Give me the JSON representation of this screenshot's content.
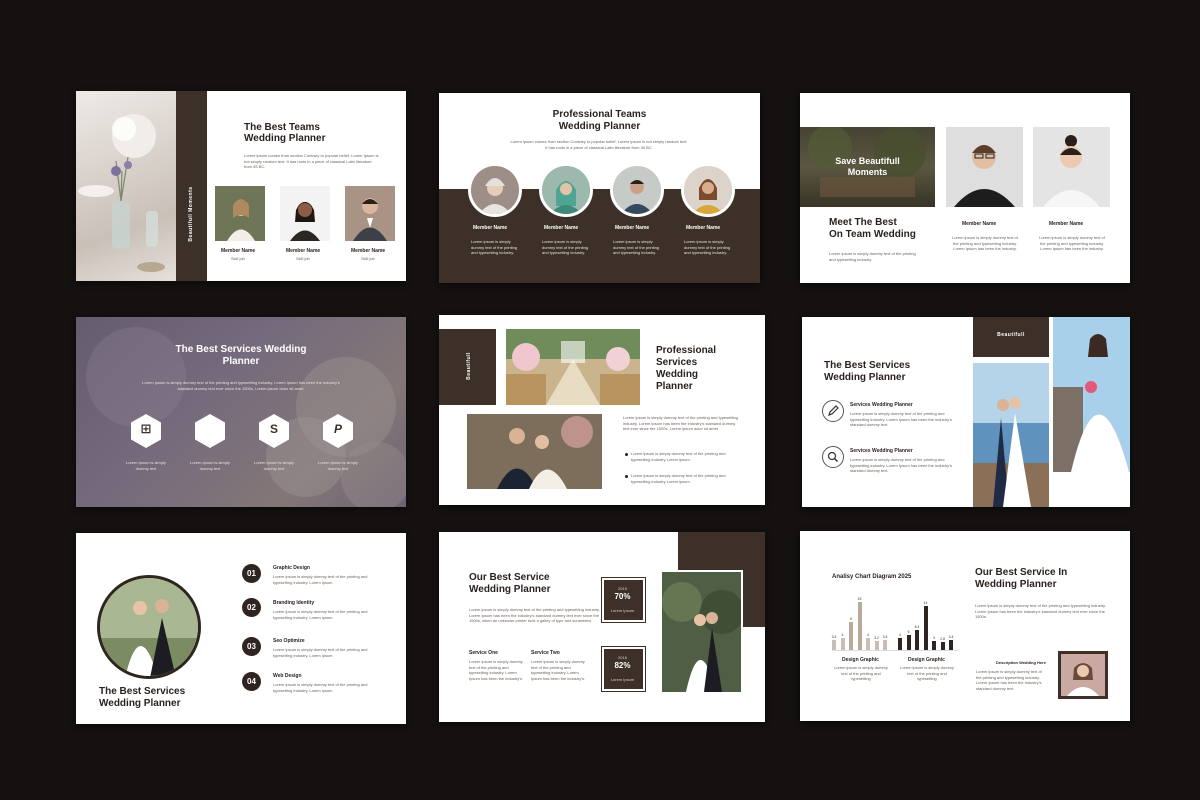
{
  "slides": {
    "s1": {
      "title1": "The Best Teams",
      "title2": "Wedding Planner",
      "body": "Lorem ipsum comes from section Contrary to popular belief, Lorem Ipsum is not simply random text. It has roots in a piece of classical Latin literature from 45 BC.",
      "side_label": "Beautifull Moments",
      "members": [
        {
          "name": "Member Name",
          "role": "Skill job"
        },
        {
          "name": "Member Name",
          "role": "Skill job"
        },
        {
          "name": "Member Name",
          "role": "Skill job"
        }
      ]
    },
    "s2": {
      "title1": "Professional Teams",
      "title2": "Wedding Planner",
      "body": "Lorem ipsum comes from section Contrary to popular belief, Lorem Ipsum is not simply random text. It has roots in a piece of classical Latin literature from 45 BC.",
      "members": [
        {
          "name": "Member Name",
          "desc": "Lorem ipsum is simply dummy text of the printing and typesetting industry."
        },
        {
          "name": "Member Name",
          "desc": "Lorem ipsum is simply dummy text of the printing and typesetting industry."
        },
        {
          "name": "Member Name",
          "desc": "Lorem ipsum is simply dummy text of the printing and typesetting industry."
        },
        {
          "name": "Member Name",
          "desc": "Lorem ipsum is simply dummy text of the printing and typesetting industry."
        }
      ]
    },
    "s3": {
      "overlay1": "Save Beautifull",
      "overlay2": "Moments",
      "title1": "Meet The Best",
      "title2": "On Team Wedding",
      "body": "Lorem ipsum is simply dummy text of the printing and typesetting industry.",
      "members": [
        {
          "name": "Member Name",
          "desc": "Lorem ipsum is simply dummy text of the printing and typesetting industry. Lorem Ipsum has been the industry."
        },
        {
          "name": "Member Name",
          "desc": "Lorem ipsum is simply dummy text of the printing and typesetting industry. Lorem Ipsum has been the industry."
        }
      ]
    },
    "s4": {
      "title1": "The Best Services Wedding",
      "title2": "Planner",
      "body": "Lorem ipsum is simply dummy text of the printing and typesetting industry. Lorem Ipsum has been the industry's standard dummy text ever since the 1500s, Lorem ipsum dolor sit amet.",
      "icons": [
        {
          "name": "windows-icon",
          "glyph": "⊞",
          "desc": "Lorem Ipsum is simply dummy text"
        },
        {
          "name": "apple-icon",
          "glyph": "",
          "desc": "Lorem Ipsum is simply dummy text"
        },
        {
          "name": "skype-icon",
          "glyph": "S",
          "desc": "Lorem Ipsum is simply dummy text"
        },
        {
          "name": "paypal-icon",
          "glyph": "P",
          "desc": "Lorem Ipsum is simply dummy text"
        }
      ]
    },
    "s5": {
      "side_label": "Beautifull",
      "title1": "Professional",
      "title2": "Services",
      "title3": "Wedding",
      "title4": "Planner",
      "body": "Lorem ipsum is simply dummy text of the printing and typesetting industry. Lorem Ipsum has been the industry's standard dummy text ever since the 1500s, Lorem ipsum dolor sit amet.",
      "bullets": [
        "Lorem ipsum is simply dummy text of the printing and typesetting industry Lorem ipsum",
        "Lorem ipsum is simply dummy text of the printing and typesetting industry Lorem ipsum"
      ]
    },
    "s6": {
      "label": "Beautifull",
      "title1": "The Best Services",
      "title2": "Wedding Planner",
      "items": [
        {
          "title": "Services Wedding Planner",
          "desc": "Lorem ipsum is simply dummy text of the printing and typesetting industry. Lorem Ipsum has been the industry's standard dummy text."
        },
        {
          "title": "Services Wedding Planner",
          "desc": "Lorem ipsum is simply dummy text of the printing and typesetting industry. Lorem Ipsum has been the industry's standard dummy text."
        }
      ]
    },
    "s7": {
      "title1": "The Best Services",
      "title2": "Wedding Planner",
      "items": [
        {
          "num": "01",
          "title": "Graphic Design",
          "desc": "Lorem ipsum is simply dummy text of the printing and typesetting industry. Lorem ipsum"
        },
        {
          "num": "02",
          "title": "Branding Identity",
          "desc": "Lorem ipsum is simply dummy text of the printing and typesetting industry. Lorem ipsum"
        },
        {
          "num": "03",
          "title": "Seo Optimize",
          "desc": "Lorem ipsum is simply dummy text of the printing and typesetting industry. Lorem ipsum"
        },
        {
          "num": "04",
          "title": "Web Design",
          "desc": "Lorem ipsum is simply dummy text of the printing and typesetting industry. Lorem ipsum"
        }
      ]
    },
    "s8": {
      "title1": "Our Best Service",
      "title2": "Wedding Planner",
      "body": "Lorem ipsum is simply dummy text of the printing and typesetting industry. Lorem Ipsum has been the industry's standard dummy text ever since the 1500s, when an unknown printer took a galley of type and scrambled.",
      "services": [
        {
          "title": "Service One",
          "desc": "Lorem ipsum is simply dummy text of the printing and typesetting industry. Lorem Ipsum has been the industry's."
        },
        {
          "title": "Service Two",
          "desc": "Lorem ipsum is simply dummy text of the printing and typesetting industry. Lorem Ipsum has been the industry's."
        }
      ],
      "stats": [
        {
          "year": "2015",
          "percent": "70%",
          "label": "Lorem Ipsum"
        },
        {
          "year": "2016",
          "percent": "82%",
          "label": "Lorem Ipsum"
        }
      ]
    },
    "s9": {
      "chart_title": "Analisy Chart Diagram 2025",
      "title1": "Our Best Service In",
      "title2": "Wedding Planner",
      "body": "Lorem ipsum is simply dummy text of the printing and typesetting industry. Lorem Ipsum has been the industry's standard dummy text ever since the 1500s.",
      "desc_title": "Description Wedding Here",
      "desc_body": "Lorem ipsum is simply dummy text of the printing and typesetting industry. Lorem Ipsum has been the industry's standard dummy text.",
      "groups": [
        {
          "label": "Design Graphic",
          "desc": "Lorem ipsum is simply dummy text of the printing and typesetting"
        },
        {
          "label": "Design Graphic",
          "desc": "Lorem ipsum is simply dummy text of the printing and typesetting"
        }
      ]
    }
  },
  "chart_data": {
    "type": "bar",
    "title": "Analisy Chart Diagram 2025",
    "series": [
      {
        "values": [
          3.4,
          4,
          9,
          15,
          4,
          3.2,
          3.4
        ]
      },
      {
        "values": [
          4,
          5,
          6.4,
          14,
          3,
          2.8,
          3.4
        ]
      }
    ],
    "group_labels": [
      "Design Graphic",
      "Design Graphic"
    ],
    "ylim": [
      0,
      16
    ]
  },
  "colors": {
    "background": "#141110",
    "accent_brown": "#3d3029",
    "text_dark": "#2a221f",
    "bar_light": "#c9bdb4",
    "bar_dark": "#2e2521"
  }
}
